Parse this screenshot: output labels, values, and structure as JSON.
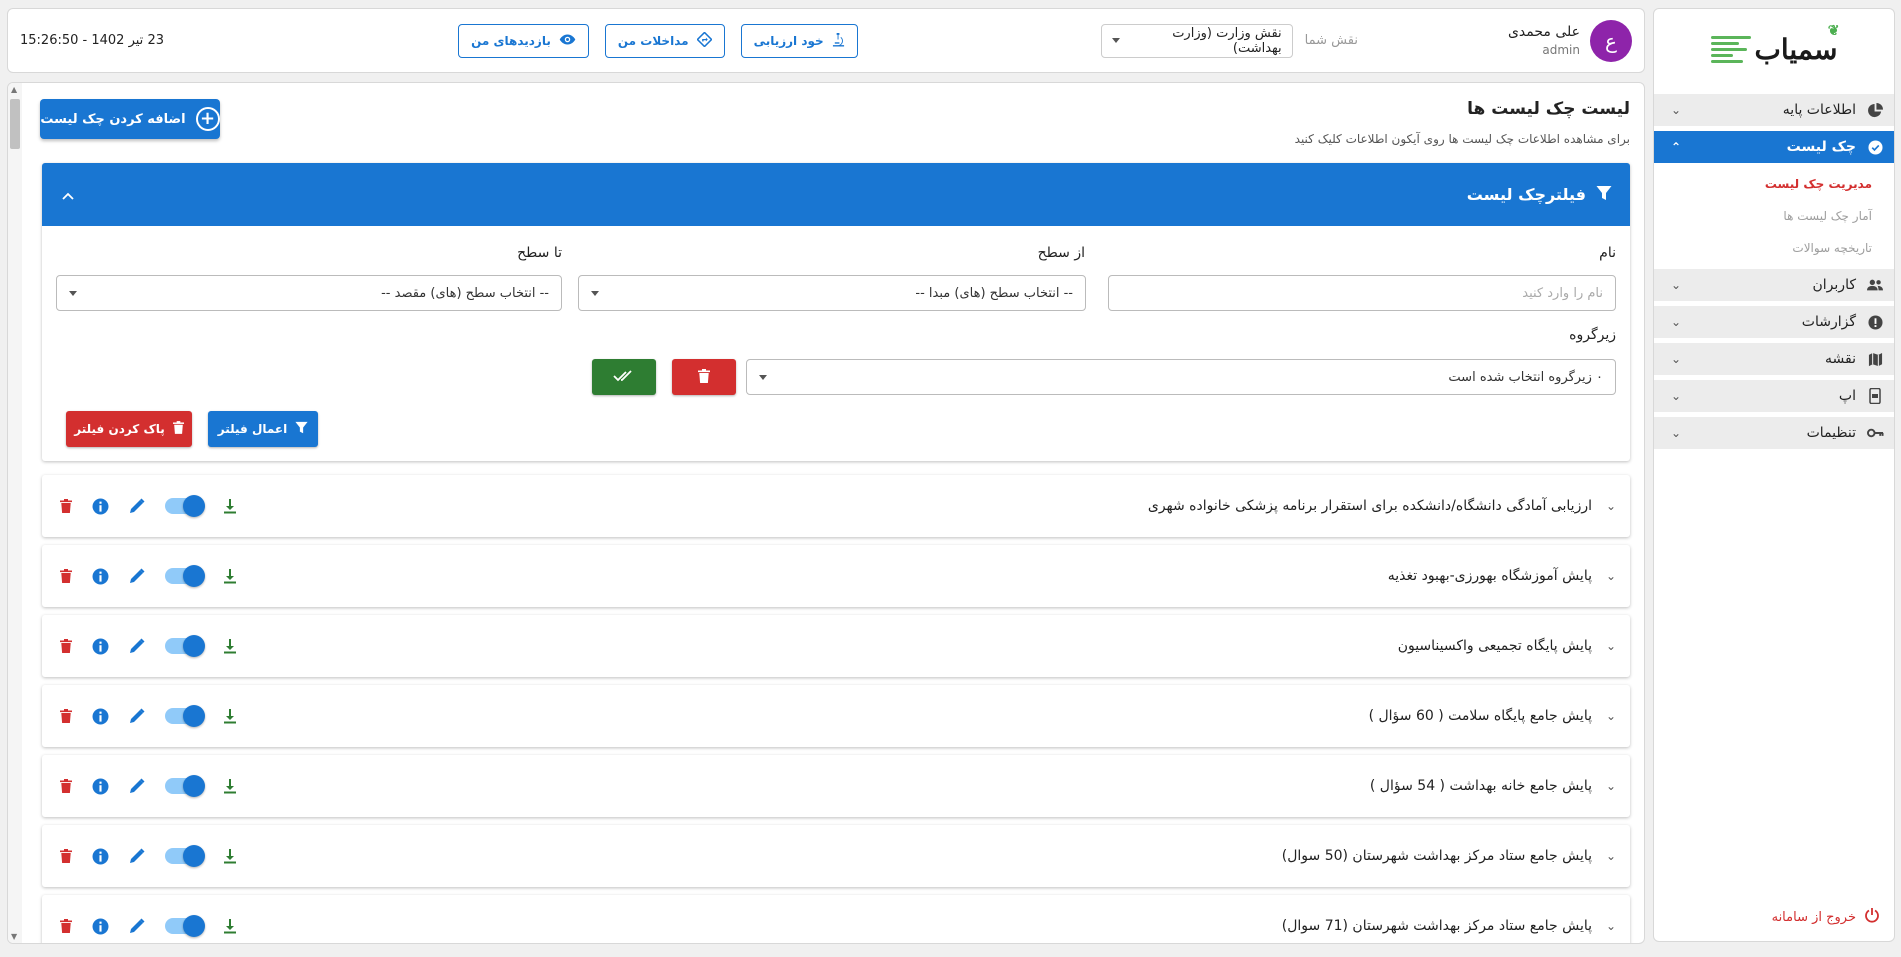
{
  "sidebar": {
    "logo_text": "سمیاب",
    "items": [
      {
        "label": "اطلاعات پایه",
        "icon": "pie-chart-icon"
      },
      {
        "label": "چک لیست",
        "icon": "check-circle-icon"
      },
      {
        "label": "کاربران",
        "icon": "users-icon"
      },
      {
        "label": "گزارشات",
        "icon": "alert-circle-icon"
      },
      {
        "label": "نقشه",
        "icon": "map-icon"
      },
      {
        "label": "اپ",
        "icon": "mobile-icon"
      },
      {
        "label": "تنظیمات",
        "icon": "key-icon"
      }
    ],
    "sub_items": [
      {
        "label": "مدیریت چک لیست"
      },
      {
        "label": "آمار چک لیست ها"
      },
      {
        "label": "تاریخچه سوالات"
      }
    ],
    "logout_label": "خروج از سامانه"
  },
  "header": {
    "user_initial": "ع",
    "user_name": "علی محمدی",
    "user_role": "admin",
    "role_label": "نقش شما",
    "role_value": "نقش وزارت (وزارت بهداشت)",
    "buttons": {
      "self_assessment": "خود ارزیابی",
      "my_interventions": "مداخلات من",
      "my_visits": "بازدیدهای من"
    },
    "datetime": "23 تیر 1402 - 15:26:50"
  },
  "main": {
    "title": "لیست چک لیست ها",
    "subtitle": "برای مشاهده اطلاعات چک لیست ها روی آیکون اطلاعات کلیک کنید",
    "add_button": "اضافه کردن چک لیست"
  },
  "filter": {
    "title": "فیلترچک لیست",
    "name_label": "نام",
    "name_placeholder": "نام را وارد کنید",
    "from_level_label": "از سطح",
    "from_level_value": "-- انتخاب سطح (های) مبدا --",
    "to_level_label": "تا سطح",
    "to_level_value": "-- انتخاب سطح (های) مقصد --",
    "subgroup_label": "زیرگروه",
    "subgroup_value": "۰ زیرگروه انتخاب شده است",
    "apply_label": "اعمال فیلتر",
    "clear_label": "پاک کردن فیلتر"
  },
  "checklists": [
    {
      "title": "ارزیابی آمادگی دانشگاه/دانشکده برای استقرار برنامه پزشکی خانواده شهری"
    },
    {
      "title": "پایش آموزشگاه بهورزی-بهبود تغذیه"
    },
    {
      "title": "پایش پایگاه تجمیعی واکسیناسیون"
    },
    {
      "title": "پایش جامع پایگاه سلامت ( 60 سؤال )"
    },
    {
      "title": "پایش جامع خانه بهداشت ( 54 سؤال )"
    },
    {
      "title": "پایش جامع ستاد مرکز بهداشت شهرستان (50 سوال)"
    },
    {
      "title": "پایش جامع ستاد مرکز بهداشت شهرستان (71 سوال)"
    }
  ],
  "colors": {
    "primary": "#1976d2",
    "danger": "#d32f2f",
    "success": "#2e7d32",
    "avatar": "#8e24aa",
    "logo_green": "#5bb55a"
  }
}
